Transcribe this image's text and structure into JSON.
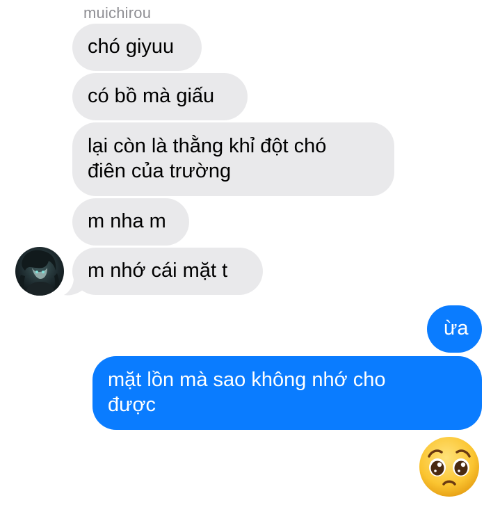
{
  "thread": {
    "sender_name": "muichirou",
    "incoming": [
      {
        "text": "chó giyuu"
      },
      {
        "text": "có bồ mà giấu"
      },
      {
        "line1": "lại còn là thằng khỉ đột chó",
        "line2": "điên của trường"
      },
      {
        "text": "m nha m"
      },
      {
        "text": "m nhớ cái mặt t"
      }
    ],
    "outgoing": [
      {
        "text": "ừa"
      },
      {
        "line1": "mặt lồn mà sao không nhớ cho",
        "line2": "được"
      }
    ],
    "reaction_emoji": "pleading-face-emoji"
  },
  "colors": {
    "incoming_bubble": "#e9e9eb",
    "outgoing_bubble": "#0a7cff",
    "sender_name": "#8e8e93"
  }
}
